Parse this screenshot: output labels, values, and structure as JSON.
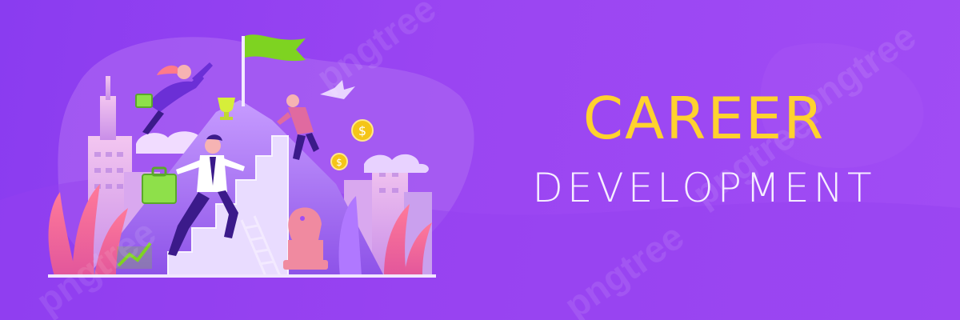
{
  "banner": {
    "title": "CAREER",
    "subtitle": "DEVELOPMENT"
  },
  "colors": {
    "background": "#9a45f2",
    "title": "#ffd22e",
    "subtitle": "#f6eeff",
    "flag": "#7ed321",
    "coin": "#f5c518",
    "figure_jacket": "#6b2fd6"
  },
  "icons": [
    "flag-icon",
    "trophy-icon",
    "dollar-coin-icon",
    "chess-knight-icon",
    "growth-chart-icon",
    "briefcase-icon",
    "bird-icon"
  ],
  "watermark": {
    "brand": "pngtree"
  }
}
